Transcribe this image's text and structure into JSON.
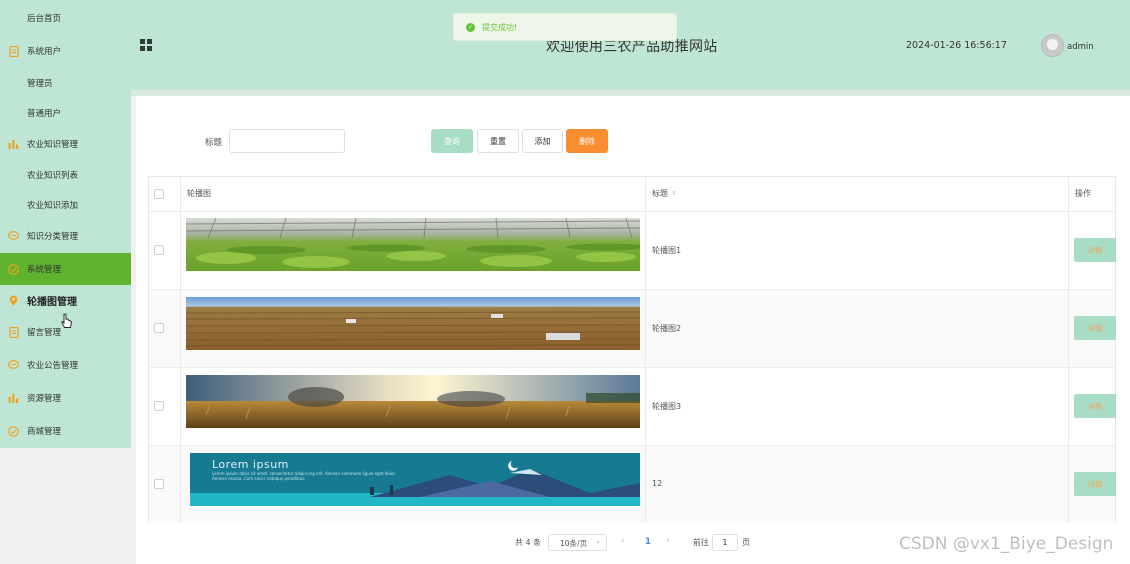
{
  "sidebar": {
    "items": [
      {
        "label": "后台首页",
        "icon": "none"
      },
      {
        "label": "系统用户",
        "icon": "document-icon"
      },
      {
        "label": "管理员",
        "icon": "none"
      },
      {
        "label": "普通用户",
        "icon": "none"
      },
      {
        "label": "农业知识管理",
        "icon": "bar-chart-icon"
      },
      {
        "label": "农业知识列表",
        "icon": "none"
      },
      {
        "label": "农业知识添加",
        "icon": "none"
      },
      {
        "label": "知识分类管理",
        "icon": "chat-bubble-icon"
      },
      {
        "label": "系统管理",
        "icon": "check-circle-icon"
      },
      {
        "label": "轮播图管理",
        "icon": "location-pin-icon"
      },
      {
        "label": "留言管理",
        "icon": "document-icon"
      },
      {
        "label": "农业公告管理",
        "icon": "chat-bubble-icon"
      },
      {
        "label": "资源管理",
        "icon": "bar-chart-icon"
      },
      {
        "label": "商城管理",
        "icon": "check-circle-icon"
      }
    ],
    "active_color": "#5fb32f",
    "icon_color": "#f0a020"
  },
  "header": {
    "title": "欢迎使用三农产品助推网站",
    "datetime": "2024-01-26 16:56:17",
    "username": "admin",
    "background": "#bfe6d4"
  },
  "toast": {
    "message": "提交成功!",
    "icon": "success-check-icon",
    "color": "#67c23a"
  },
  "search": {
    "label": "标题",
    "value": "",
    "buttons": {
      "search": "查询",
      "reset": "重置",
      "add": "添加",
      "delete": "删除"
    }
  },
  "table": {
    "columns": {
      "image": "轮播图",
      "title": "标题",
      "actions": "操作"
    },
    "rows": [
      {
        "title": "轮播图1",
        "image": "greenhouse-lettuce-photo",
        "action": "详情"
      },
      {
        "title": "轮播图2",
        "image": "plowed-field-photo",
        "action": "详情"
      },
      {
        "title": "轮播图3",
        "image": "wheat-harvest-sunset-photo",
        "action": "详情"
      },
      {
        "title": "12",
        "image": "lorem-ipsum-mountain-banner",
        "action": "详情"
      }
    ]
  },
  "banner4": {
    "heading": "Lorem ipsum",
    "body": "Lorem ipsum dolor sit amet, consectetur adipiscing elit. Aenean commodo ligula eget dolor. Aenean massa. Cum sociis natoque penatibus."
  },
  "pagination": {
    "total": "共 4 条",
    "page_size": "10条/页",
    "current_page": "1",
    "goto_label": "前往",
    "goto_value": "1",
    "page_suffix": "页"
  },
  "watermark": "CSDN @vx1_Biye_Design"
}
